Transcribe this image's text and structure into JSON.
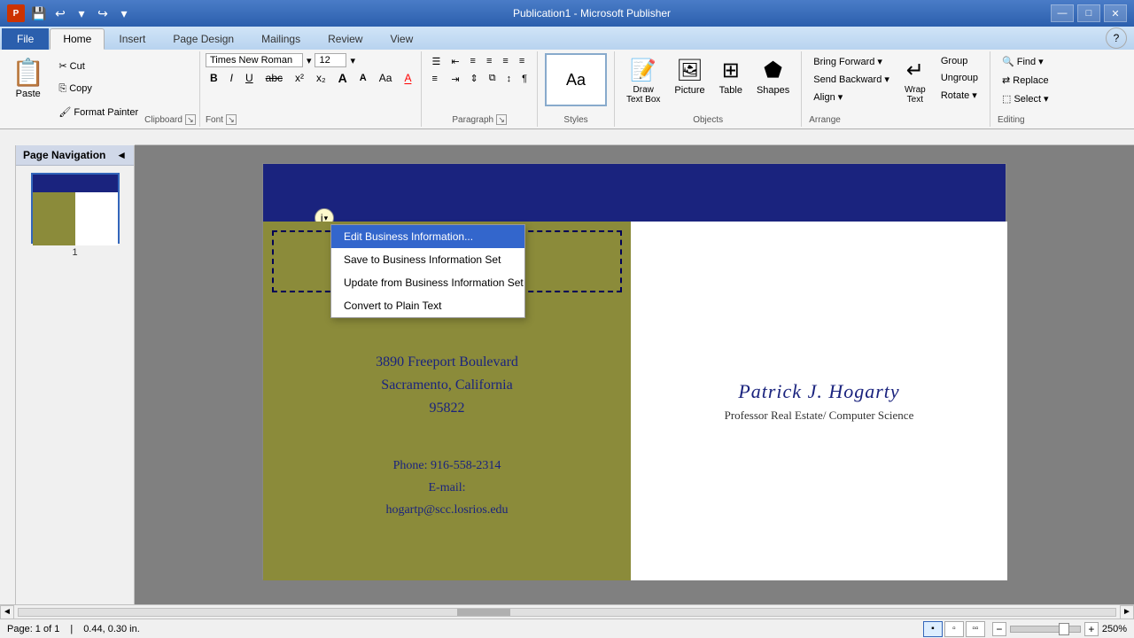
{
  "window": {
    "title": "Publication1 - Microsoft Publisher",
    "min_btn": "—",
    "restore_btn": "□",
    "close_btn": "✕"
  },
  "ribbon_tabs": {
    "file": "File",
    "home": "Home",
    "insert": "Insert",
    "page_design": "Page Design",
    "mailings": "Mailings",
    "review": "Review",
    "view": "View",
    "help_icon": "?"
  },
  "clipboard": {
    "paste_label": "Paste",
    "cut_label": "✂ Cut",
    "copy_label": "⎘ Copy",
    "format_painter": "🖌 Format Painter",
    "group_label": "Clipboard"
  },
  "font": {
    "name": "Times New Roman",
    "size": "12",
    "bold": "B",
    "italic": "I",
    "underline": "U",
    "strikethrough": "abc",
    "superscript": "x²",
    "subscript": "x₂",
    "grow": "A",
    "shrink": "A",
    "change_case": "Aa",
    "font_color": "A",
    "group_label": "Font"
  },
  "paragraph": {
    "group_label": "Paragraph"
  },
  "styles": {
    "label": "Styles",
    "text": "Aa"
  },
  "objects": {
    "picture_label": "Picture",
    "table_label": "Table",
    "shapes_label": "Shapes",
    "draw_text_box_label": "Draw\nText Box",
    "group_label": "Objects"
  },
  "arrange": {
    "bring_forward": "Bring Forward",
    "send_backward": "Send Backward",
    "align": "Align",
    "wrap_text": "Wrap\nText",
    "group": "Group",
    "ungroup": "Ungroup",
    "rotate": "Rotate",
    "group_label": "Arrange"
  },
  "editing": {
    "find": "Find",
    "replace": "Replace",
    "select": "Select",
    "group_label": "Editing"
  },
  "sidebar": {
    "title": "Page Navigation",
    "collapse_icon": "◄",
    "page_num": "1"
  },
  "page": {
    "address_line1": "3890 Freeport Boulevard",
    "address_line2": "Sacramento, California",
    "address_line3": "95822",
    "phone": "Phone: 916-558-2314",
    "email_label": "E-mail:",
    "email": "hogartp@scc.losrios.edu",
    "name": "Patrick J. Hogarty",
    "title": "Professor Real Estate/ Computer Science"
  },
  "dropdown": {
    "trigger_text": "i",
    "items": [
      {
        "label": "Edit Business Information...",
        "hovered": true
      },
      {
        "label": "Save to Business Information Set",
        "hovered": false
      },
      {
        "label": "Update from Business Information Set",
        "hovered": false
      },
      {
        "label": "Convert to Plain Text",
        "hovered": false
      }
    ]
  },
  "status_bar": {
    "page_info": "Page: 1 of 1",
    "position": "0.44, 0.30 in.",
    "zoom_level": "250%",
    "view_modes": [
      "normal",
      "master",
      "two-page"
    ]
  }
}
